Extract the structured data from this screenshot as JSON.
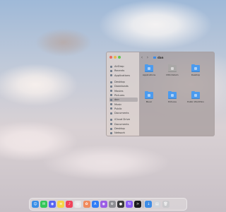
{
  "finder": {
    "title": "dan",
    "traffic_lights": [
      "#e86a5e",
      "#e7b84c",
      "#62c454"
    ],
    "sidebar": [
      {
        "label": "AirDrop",
        "icon": "airdrop-icon"
      },
      {
        "label": "Recents",
        "icon": "clock-icon"
      },
      {
        "label": "Applications",
        "icon": "applications-icon"
      },
      {
        "label": "Desktop",
        "icon": "desktop-icon"
      },
      {
        "label": "Downloads",
        "icon": "downloads-icon"
      },
      {
        "label": "Movies",
        "icon": "movies-icon"
      },
      {
        "label": "Pictures",
        "icon": "pictures-icon"
      },
      {
        "label": "dan",
        "icon": "home-icon",
        "active": true
      },
      {
        "label": "Music",
        "icon": "music-icon"
      },
      {
        "label": "Public",
        "icon": "public-icon"
      },
      {
        "label": "Documents",
        "icon": "documents-icon"
      },
      {
        "label": "iCloud Drive",
        "icon": "icloud-icon"
      },
      {
        "label": "Documents",
        "icon": "documents-icon"
      },
      {
        "label": "Desktop",
        "icon": "desktop-icon"
      },
      {
        "label": "Network",
        "icon": "network-icon"
      }
    ],
    "items": [
      {
        "label": "Applications",
        "icon": "applications-folder-icon",
        "grey": false
      },
      {
        "label": "DSS Datum",
        "icon": "folder-icon",
        "grey": true
      },
      {
        "label": "Desktop",
        "icon": "desktop-folder-icon",
        "grey": false
      },
      {
        "label": "Movies",
        "icon": "movies-folder-icon",
        "grey": false
      },
      {
        "label": "Music",
        "icon": "music-folder-icon",
        "grey": false
      },
      {
        "label": "Pictures",
        "icon": "pictures-folder-icon",
        "grey": false
      },
      {
        "label": "Public Workfolio",
        "icon": "folder-icon",
        "grey": false
      }
    ]
  },
  "dock": [
    {
      "name": "finder-icon",
      "color": "#3a8ee6",
      "glyph": "☺"
    },
    {
      "name": "messages-icon",
      "color": "#34c759",
      "glyph": "✉"
    },
    {
      "name": "discord-icon",
      "color": "#5865f2",
      "glyph": "◉"
    },
    {
      "name": "notes-icon",
      "color": "#f5d547",
      "glyph": "≡"
    },
    {
      "name": "music-icon",
      "color": "#f0435a",
      "glyph": "♪"
    },
    {
      "name": "safari-icon",
      "color": "#e7e7e7",
      "glyph": "◎"
    },
    {
      "name": "photos-icon",
      "color": "#f08a5d",
      "glyph": "✿"
    },
    {
      "name": "app-store-icon",
      "color": "#2f7df6",
      "glyph": "A"
    },
    {
      "name": "podcasts-icon",
      "color": "#9b5de5",
      "glyph": "◉"
    },
    {
      "name": "system-settings-icon",
      "color": "#8e8e93",
      "glyph": "⚙"
    },
    {
      "name": "obs-icon",
      "color": "#3a3a3c",
      "glyph": "●"
    },
    {
      "name": "notion-icon",
      "color": "#8a5cf6",
      "glyph": "N"
    },
    {
      "name": "terminal-icon",
      "color": "#1c1c1e",
      "glyph": ">"
    },
    {
      "name": "downloads-stack-icon",
      "color": "#3d8ce6",
      "glyph": "↓"
    },
    {
      "name": "documents-stack-icon",
      "color": "#d0d4da",
      "glyph": "▤"
    },
    {
      "name": "trash-icon",
      "color": "#c9c9cc",
      "glyph": "🗑"
    }
  ]
}
